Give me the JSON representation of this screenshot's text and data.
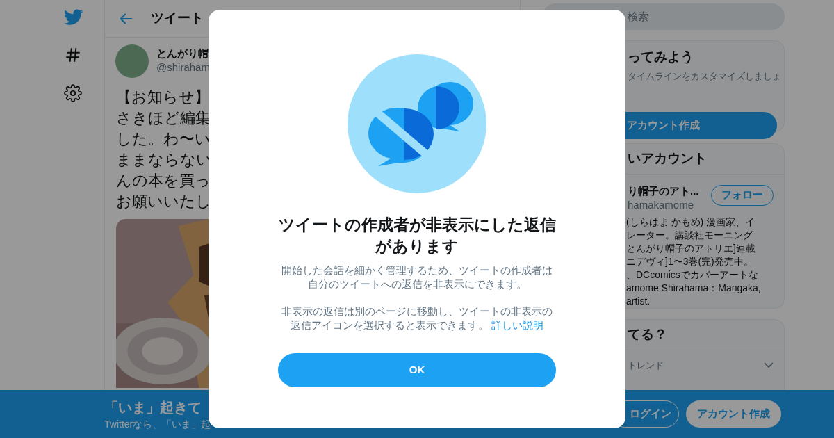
{
  "header": {
    "title": "ツイート"
  },
  "tweet": {
    "author_name": "とんがり帽",
    "handle": "@shiraham",
    "lines": [
      "【お知らせ】",
      "さきほど編集",
      "した。わ〜い",
      "ままならない",
      "んの本を買っ",
      "お願いいたし"
    ]
  },
  "right_column": {
    "search": {
      "placeholder": "検索"
    },
    "signup_card": {
      "title": "ってみよう",
      "text": "タイムラインをカスタマイズしましょ",
      "button": "アカウント作成"
    },
    "suggest_card": {
      "title": "いアカウント",
      "user": {
        "name": "り帽子のアト...",
        "handle": "hamakamome",
        "follow": "フォロー",
        "bio": [
          "(しらはま かもめ) 漫画家、イ",
          "レーター。講談社モーニング",
          "とんがり帽子のアトリエ]連載",
          "ニデヴィ]1〜3巻(完)発売中。",
          "、DCcomicsでカバーアートな",
          "amome Shirahama：Mangaka,",
          "artist."
        ]
      }
    },
    "trends_card": {
      "title": "てる？",
      "subtitle": "トレンド"
    }
  },
  "bottom_bar": {
    "title": "「いま」起きて",
    "text": "Twitterなら、「いま」起",
    "login": "ログイン",
    "signup": "アカウント作成"
  },
  "dialog": {
    "title": "ツイートの作成者が非表示にした返信があります",
    "paragraphs": [
      "開始した会話を細かく管理するため、ツイートの作成者は自分のツイートへの返信を非表示にできます。",
      "非表示の返信は別のページに移動し、ツイートの非表示の返信アイコンを選択すると表示できます。"
    ],
    "link": "詳しい説明",
    "button": "OK"
  }
}
